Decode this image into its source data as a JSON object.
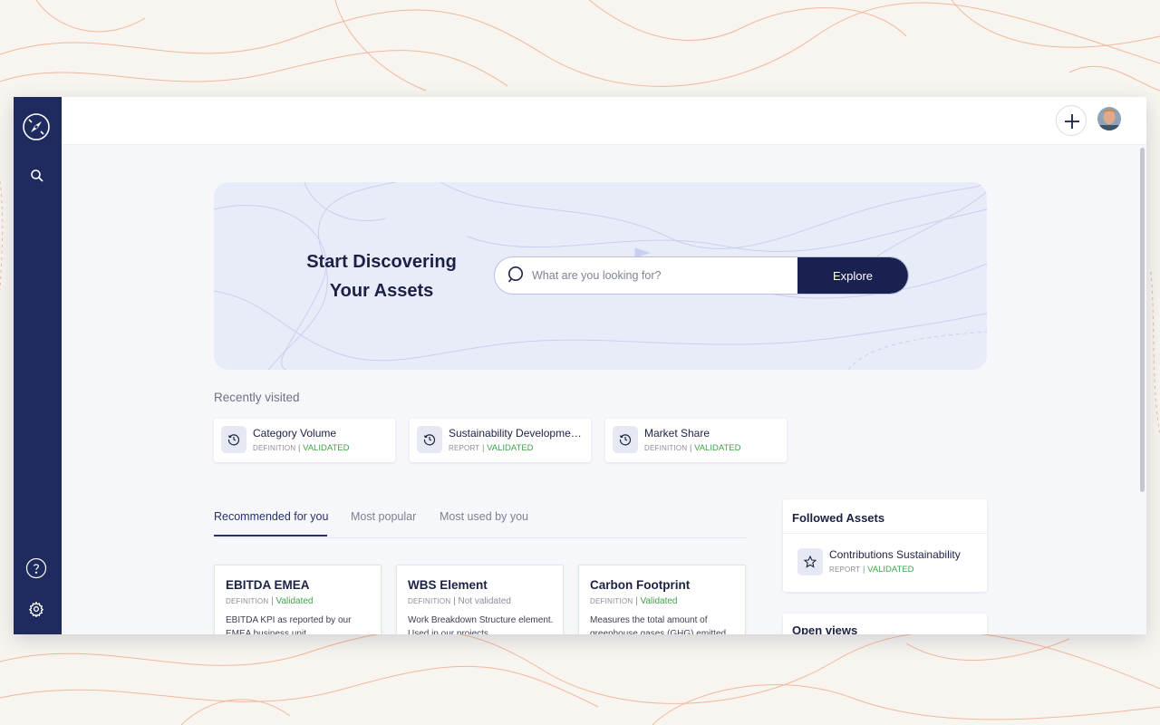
{
  "hero": {
    "title_line1": "Start Discovering",
    "title_line2": "Your Assets",
    "search_placeholder": "What are you looking for?",
    "explore_label": "Explore"
  },
  "recent": {
    "title": "Recently visited",
    "items": [
      {
        "name": "Category Volume",
        "type": "DEFINITION",
        "status": "VALIDATED",
        "icon": "history-icon"
      },
      {
        "name": "Sustainability Development Report",
        "type": "REPORT",
        "status": "VALIDATED",
        "icon": "history-icon"
      },
      {
        "name": "Market Share",
        "type": "DEFINITION",
        "status": "VALIDATED",
        "icon": "history-icon"
      }
    ]
  },
  "tabs": [
    {
      "label": "Recommended for you",
      "active": true
    },
    {
      "label": "Most popular",
      "active": false
    },
    {
      "label": "Most used by you",
      "active": false
    }
  ],
  "recommended": [
    {
      "title": "EBITDA EMEA",
      "type": "DEFINITION",
      "status": "Validated",
      "desc": "EBITDA KPI as reported by our EMEA business unit"
    },
    {
      "title": "WBS Element",
      "type": "DEFINITION",
      "status": "Not validated",
      "desc": "Work Breakdown Structure element. Used in our projects"
    },
    {
      "title": "Carbon Footprint",
      "type": "DEFINITION",
      "status": "Validated",
      "desc": "Measures the total amount of greenhouse gases (GHG) emitted"
    }
  ],
  "followed": {
    "title": "Followed Assets",
    "items": [
      {
        "name": "Contributions Sustainability",
        "type": "REPORT",
        "status": "VALIDATED",
        "icon": "star-icon"
      }
    ]
  },
  "open_views": {
    "title": "Open views"
  },
  "sep": "|",
  "colors": {
    "sidebar": "#1f2b5e",
    "accent": "#1a2150",
    "validated": "#3fa34a",
    "hero_bg": "#e8ecf8"
  },
  "icons": {
    "logo": "compass-logo-icon",
    "sidebar_search": "search-icon",
    "help": "help-icon",
    "settings": "gear-icon",
    "add": "plus-icon",
    "user": "avatar"
  }
}
